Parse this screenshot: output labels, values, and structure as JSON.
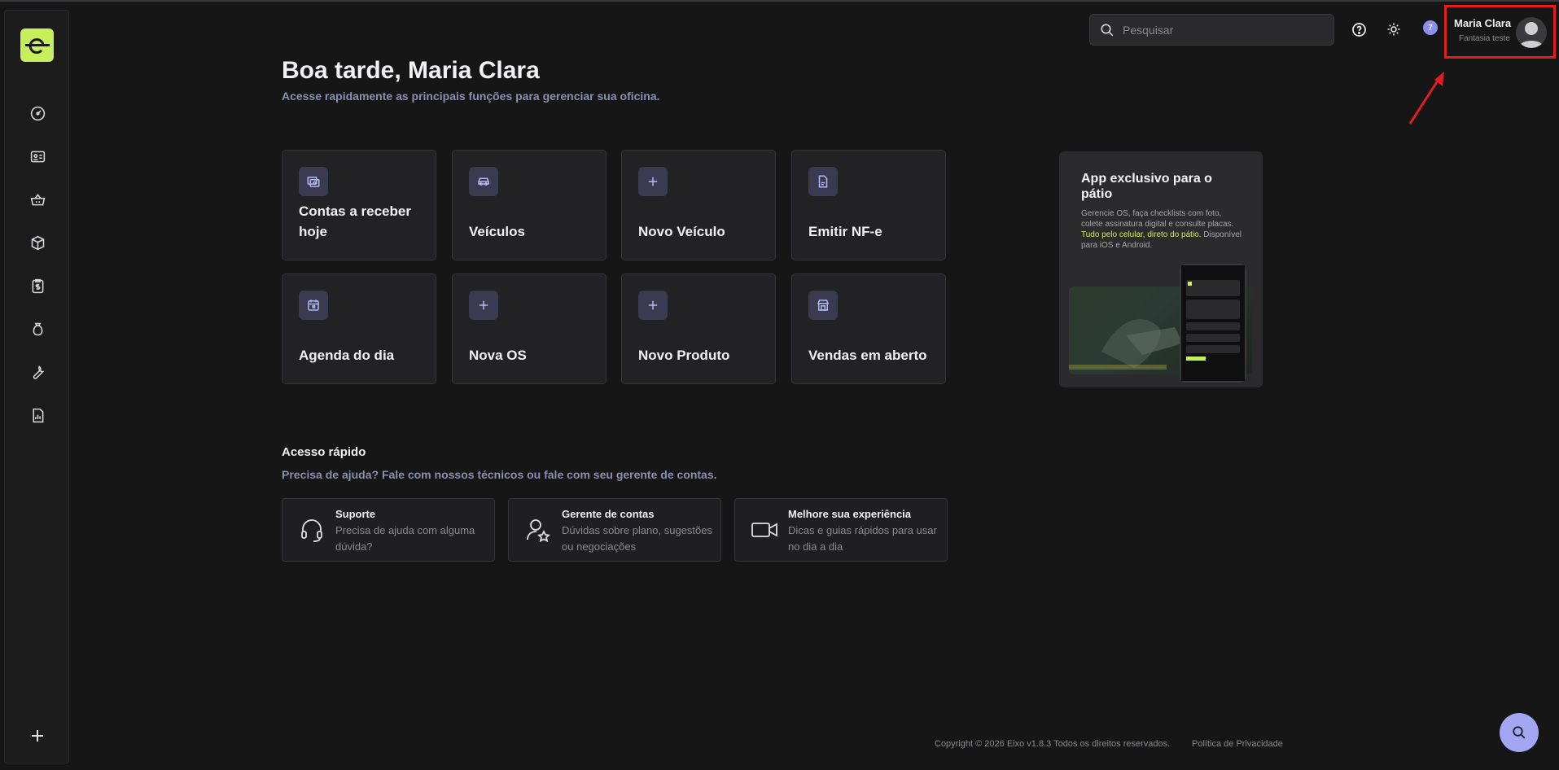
{
  "header": {
    "search_placeholder": "Pesquisar",
    "notification_count": "7",
    "user": {
      "name": "Maria Clara",
      "company": "Fantasia teste"
    }
  },
  "sidebar": {
    "items": [
      {
        "icon": "dashboard-icon"
      },
      {
        "icon": "id-card-icon"
      },
      {
        "icon": "basket-icon"
      },
      {
        "icon": "box-icon"
      },
      {
        "icon": "invoice-icon"
      },
      {
        "icon": "money-bag-icon"
      },
      {
        "icon": "wrench-icon"
      },
      {
        "icon": "report-icon"
      }
    ]
  },
  "main": {
    "greeting": "Boa tarde, Maria Clara",
    "subtitle": "Acesse rapidamente as principais funções para gerenciar sua oficina.",
    "cards": [
      {
        "label": "Contas a receber hoje",
        "icon": "money-calendar-icon"
      },
      {
        "label": "Veículos",
        "icon": "car-icon"
      },
      {
        "label": "Novo Veículo",
        "icon": "plus-icon"
      },
      {
        "label": "Emitir NF-e",
        "icon": "document-icon"
      },
      {
        "label": "Agenda do dia",
        "icon": "calendar-icon"
      },
      {
        "label": "Nova OS",
        "icon": "plus-icon"
      },
      {
        "label": "Novo Produto",
        "icon": "plus-icon"
      },
      {
        "label": "Vendas em aberto",
        "icon": "store-icon"
      }
    ]
  },
  "promo": {
    "title": "App exclusivo para o pátio",
    "text_before": "Gerencie OS, faça checklists com foto, colete assinatura digital e consulte placas. ",
    "text_highlight": "Tudo pelo celular, direto do pátio.",
    "text_after": " Disponível para iOS e Android."
  },
  "quick_access": {
    "title": "Acesso rápido",
    "subtitle": "Precisa de ajuda? Fale com nossos técnicos ou fale com seu gerente de contas.",
    "items": [
      {
        "title": "Suporte",
        "description": "Precisa de ajuda com alguma dúvida?",
        "icon": "headset-icon"
      },
      {
        "title": "Gerente de contas",
        "description": "Dúvidas sobre plano, sugestões ou negociações",
        "icon": "user-star-icon"
      },
      {
        "title": "Melhore sua experiência",
        "description": "Dicas e guias rápidos para usar no dia a dia",
        "icon": "video-icon"
      }
    ]
  },
  "footer": {
    "copyright": "Copyright © 2026 Eixo v1.8.3 Todos os direitos reservados.",
    "privacy": "Política de Privacidade"
  },
  "colors": {
    "accent_lime": "#c7ef5b",
    "accent_purple": "#a3a6f3",
    "highlight_red": "#e01e1e"
  }
}
